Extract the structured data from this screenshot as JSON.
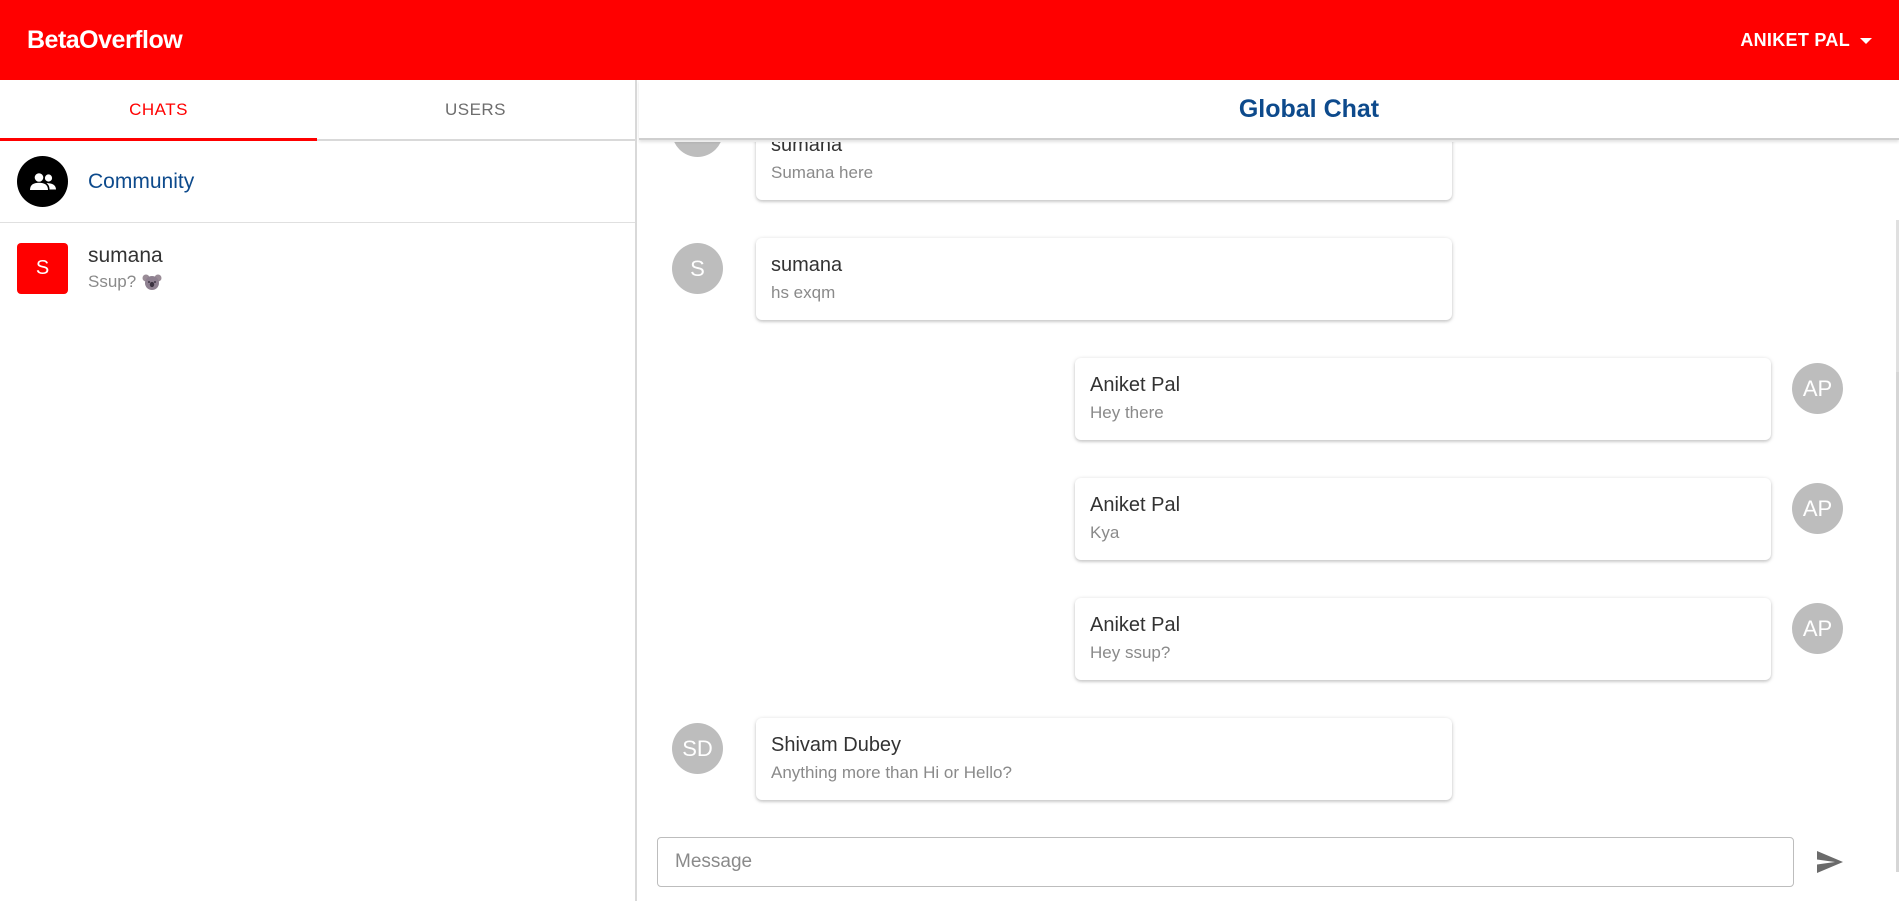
{
  "app": {
    "brand": "BetaOverflow",
    "user_menu_label": "ANIKET PAL"
  },
  "colors": {
    "primary": "#ff0000",
    "title_blue": "#0d4a8c",
    "avatar_grey": "#bdbdbd"
  },
  "sidebar": {
    "tabs": [
      {
        "label": "CHATS",
        "active": true
      },
      {
        "label": "USERS",
        "active": false
      }
    ],
    "chats": [
      {
        "name": "Community",
        "icon": "group-icon"
      },
      {
        "name": "sumana",
        "avatar": "S",
        "preview": "Ssup?",
        "emoji": "koala-emoji"
      }
    ]
  },
  "main": {
    "title": "Global Chat",
    "messages": [
      {
        "sender": "sumana",
        "text": "Sumana here",
        "avatar": "",
        "side": "left"
      },
      {
        "sender": "sumana",
        "text": "hs exqm",
        "avatar": "S",
        "side": "left"
      },
      {
        "sender": "Aniket Pal",
        "text": "Hey there",
        "avatar": "AP",
        "side": "right"
      },
      {
        "sender": "Aniket Pal",
        "text": "Kya",
        "avatar": "AP",
        "side": "right"
      },
      {
        "sender": "Aniket Pal",
        "text": "Hey ssup?",
        "avatar": "AP",
        "side": "right"
      },
      {
        "sender": "Shivam Dubey",
        "text": "Anything more than Hi or Hello?",
        "avatar": "SD",
        "side": "left"
      }
    ],
    "composer": {
      "placeholder": "Message",
      "send_icon": "send-icon"
    }
  }
}
